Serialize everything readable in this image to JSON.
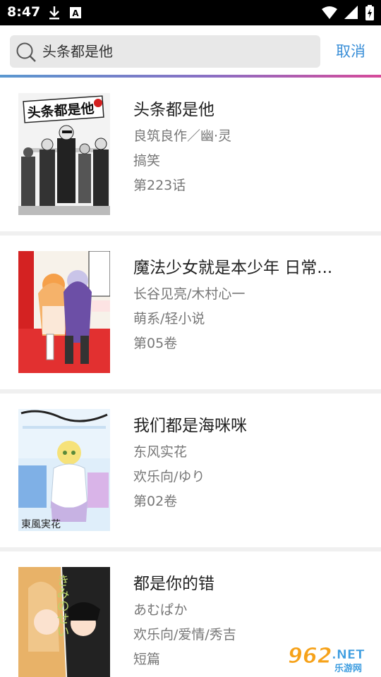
{
  "status_bar": {
    "time": "8:47",
    "icons_left": [
      "download-icon",
      "a-notification-icon"
    ],
    "icons_right": [
      "wifi-icon",
      "signal-icon",
      "battery-charging-icon"
    ]
  },
  "search": {
    "query": "头条都是他",
    "cancel_label": "取消"
  },
  "colors": {
    "accent": "#3a8fd8",
    "gradient_start": "#5a98d0",
    "gradient_end": "#d64a9a"
  },
  "results": [
    {
      "title": "头条都是他",
      "author": "良筑良作／幽·灵",
      "genre": "搞笑",
      "chapter": "第223话",
      "cover_text": "头条都是他"
    },
    {
      "title": "魔法少女就是本少年 日常...",
      "author": "长谷见亮/木村心一",
      "genre": "萌系/轻小说",
      "chapter": "第05卷",
      "cover_text": ""
    },
    {
      "title": "我们都是海咪咪",
      "author": "东风实花",
      "genre": "欢乐向/ゆり",
      "chapter": "第02卷",
      "cover_text": "東風実花"
    },
    {
      "title": "都是你的错",
      "author": "あむぱか",
      "genre": "欢乐向/爱情/秀吉",
      "chapter": "短篇",
      "cover_text": "きみのせい"
    }
  ],
  "watermark": {
    "number": "962",
    "suffix": ".NET",
    "sub": "乐游网"
  }
}
